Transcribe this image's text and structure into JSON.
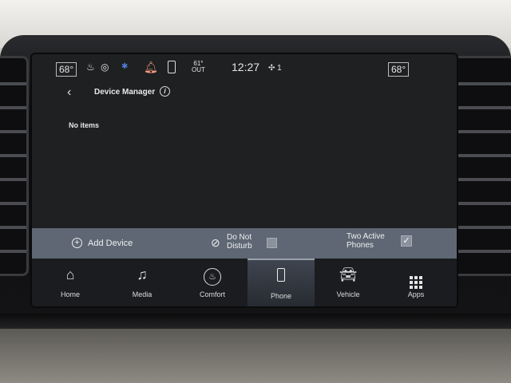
{
  "status_bar": {
    "temp_left": "68°",
    "temp_right": "68°",
    "clock": "12:27",
    "outside_temp": "61°",
    "outside_label": "OUT",
    "fan_level": "1"
  },
  "header": {
    "title": "Device Manager",
    "icons": [
      "back-arrow-icon",
      "info-icon"
    ]
  },
  "content": {
    "empty_message": "No items"
  },
  "actions": {
    "add_device_label": "Add Device",
    "do_not_disturb_label": "Do Not Disturb",
    "do_not_disturb_checked": false,
    "two_active_phones_label": "Two Active Phones",
    "two_active_phones_checked": true
  },
  "nav": {
    "items": [
      {
        "label": "Home",
        "icon": "home-icon"
      },
      {
        "label": "Media",
        "icon": "music-note-icon"
      },
      {
        "label": "Comfort",
        "icon": "seat-comfort-icon"
      },
      {
        "label": "Phone",
        "icon": "phone-icon",
        "active": true
      },
      {
        "label": "Vehicle",
        "icon": "car-icon"
      },
      {
        "label": "Apps",
        "icon": "apps-grid-icon"
      }
    ]
  }
}
